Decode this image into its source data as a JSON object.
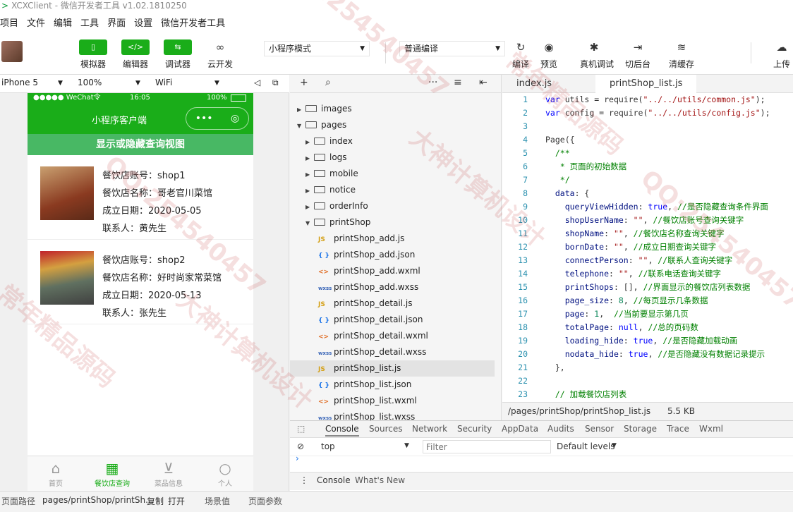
{
  "window": {
    "title": "XCXClient - 微信开发者工具 v1.02.1810250"
  },
  "menu": [
    "项目",
    "文件",
    "编辑",
    "工具",
    "界面",
    "设置",
    "微信开发者工具"
  ],
  "toolbar": {
    "simulator": "模拟器",
    "editor": "编辑器",
    "debugger": "调试器",
    "cloud": "云开发",
    "mode": "小程序模式",
    "compile_mode": "普通编译",
    "compile": "编译",
    "preview": "预览",
    "remote_debug": "真机调试",
    "background": "切后台",
    "clear_cache": "清缓存",
    "upload": "上传"
  },
  "device": {
    "model": "iPhone 5",
    "zoom": "100%",
    "network": "WiFi"
  },
  "phone": {
    "status_left": "●●●●● WeChat令",
    "status_time": "16:05",
    "status_battery": "100%",
    "nav_title": "小程序客户端",
    "capsule_dots": "•••",
    "capsule_close": "◎",
    "toggle": "显示或隐藏查询视图",
    "shops": [
      {
        "account": "餐饮店账号：shop1",
        "name": "餐饮店名称：哥老官川菜馆",
        "date": "成立日期：2020-05-05",
        "contact": "联系人：黄先生"
      },
      {
        "account": "餐饮店账号：shop2",
        "name": "餐饮店名称：好时尚家常菜馆",
        "date": "成立日期：2020-05-13",
        "contact": "联系人：张先生"
      }
    ],
    "tabs": [
      "首页",
      "餐饮店查询",
      "菜品信息",
      "个人"
    ]
  },
  "tree": {
    "items": [
      {
        "label": "images",
        "type": "folder",
        "arrow": "▶"
      },
      {
        "label": "pages",
        "type": "folder",
        "arrow": "▼"
      },
      {
        "label": "index",
        "type": "folder",
        "arrow": "▶"
      },
      {
        "label": "logs",
        "type": "folder",
        "arrow": "▶"
      },
      {
        "label": "mobile",
        "type": "folder",
        "arrow": "▶"
      },
      {
        "label": "notice",
        "type": "folder",
        "arrow": "▶"
      },
      {
        "label": "orderInfo",
        "type": "folder",
        "arrow": "▶"
      },
      {
        "label": "printShop",
        "type": "folder",
        "arrow": "▼"
      },
      {
        "label": "printShop_add.js",
        "type": "JS"
      },
      {
        "label": "printShop_add.json",
        "type": "{}"
      },
      {
        "label": "printShop_add.wxml",
        "type": "<>"
      },
      {
        "label": "printShop_add.wxss",
        "type": "wxss"
      },
      {
        "label": "printShop_detail.js",
        "type": "JS"
      },
      {
        "label": "printShop_detail.json",
        "type": "{}"
      },
      {
        "label": "printShop_detail.wxml",
        "type": "<>"
      },
      {
        "label": "printShop_detail.wxss",
        "type": "wxss"
      },
      {
        "label": "printShop_list.js",
        "type": "JS",
        "selected": true
      },
      {
        "label": "printShop_list.json",
        "type": "{}"
      },
      {
        "label": "printShop_list.wxml",
        "type": "<>"
      },
      {
        "label": "printShop_list.wxss",
        "type": "wxss"
      }
    ]
  },
  "editor": {
    "tabs": [
      "index.js",
      "printShop_list.js"
    ],
    "file_path": "/pages/printShop/printShop_list.js",
    "file_size": "5.5 KB"
  },
  "console": {
    "tabs": [
      "Console",
      "Sources",
      "Network",
      "Security",
      "AppData",
      "Audits",
      "Sensor",
      "Storage",
      "Trace",
      "Wxml"
    ],
    "context": "top",
    "filter_placeholder": "Filter",
    "levels": "Default levels",
    "prompt": "›",
    "drawer_tabs": [
      "Console",
      "What's New"
    ]
  },
  "pathbar": {
    "label": "页面路径",
    "path": "pages/printShop/printSh...",
    "copy": "复制",
    "open": "打开",
    "scene": "场景值",
    "params": "页面参数"
  },
  "watermarks": [
    "QQ:254540457",
    "大神计算机设计",
    "常年精品源码",
    "QQ:254540457",
    "大神计算机设计",
    "QQ:254540457",
    "常年精品源码"
  ]
}
